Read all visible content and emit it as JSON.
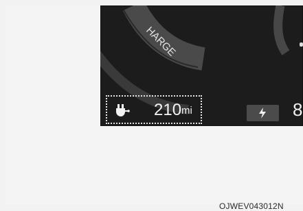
{
  "dashboard": {
    "mode_fragment": "HARGE",
    "range": {
      "value": "210",
      "unit": "mi"
    },
    "battery_fragment": "8",
    "colors": {
      "panel": "#1c1c1c",
      "text": "#f4f4f4",
      "badge": "#4b4b4b",
      "border": "#e7e7e7"
    },
    "icons": {
      "plug": "plug-icon",
      "charge": "lightning-icon"
    }
  },
  "figure": {
    "code": "OJWEV043012N"
  }
}
